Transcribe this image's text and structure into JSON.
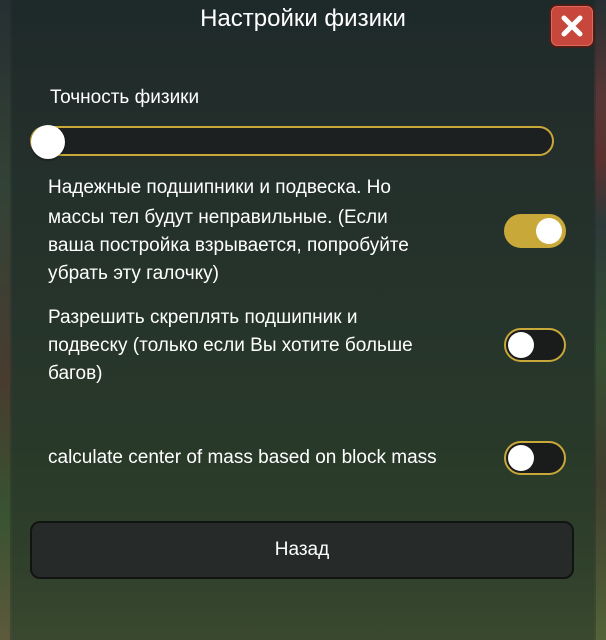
{
  "dialog": {
    "title": "Настройки физики",
    "close_icon": "close-x-icon"
  },
  "physics_accuracy": {
    "label": "Точность физики",
    "value_fraction": 0.0
  },
  "settings": [
    {
      "text": "Надежные подшипники и подвеска. Но массы тел будут неправильные. (Если ваша постройка взрывается, попробуйте убрать эту галочку)",
      "lines": [
        "Надежные подшипники и подвеска. Но",
        "массы тел будут неправильные. (Если",
        "ваша постройка взрывается, попробуйте",
        "убрать эту галочку)"
      ],
      "enabled": true
    },
    {
      "lines": [
        "Разрешить скреплять подшипник и",
        "подвеску (только если Вы хотите больше",
        "багов)"
      ],
      "enabled": false
    },
    {
      "lines": [
        "calculate center of mass based on block mass"
      ],
      "enabled": false
    }
  ],
  "back_button": {
    "label": "Назад"
  },
  "colors": {
    "accent": "#c9a83a",
    "close_button": "#c8473c",
    "text": "#ffffff"
  }
}
